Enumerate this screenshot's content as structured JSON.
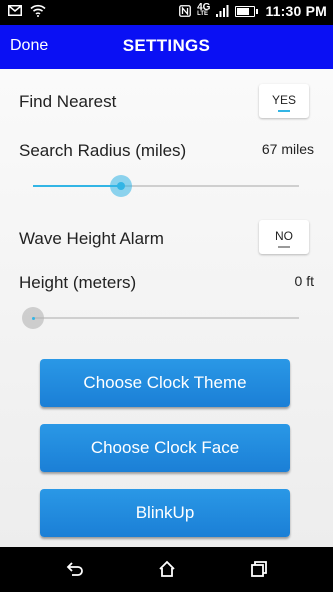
{
  "status_bar": {
    "network_label": "4G",
    "network_sublabel": "LTE",
    "time": "11:30",
    "time_suffix": "PM"
  },
  "header": {
    "done_label": "Done",
    "title": "SETTINGS"
  },
  "settings": {
    "find_nearest": {
      "label": "Find Nearest",
      "toggle": "YES",
      "on": true
    },
    "search_radius": {
      "label": "Search Radius (miles)",
      "value": "67 miles",
      "slider_fraction": 0.33
    },
    "wave_alarm": {
      "label": "Wave Height Alarm",
      "toggle": "NO",
      "on": false
    },
    "height": {
      "label": "Height (meters)",
      "value": "0 ft",
      "slider_fraction": 0.0
    }
  },
  "buttons": {
    "clock_theme": "Choose Clock Theme",
    "clock_face": "Choose Clock Face",
    "blinkup": "BlinkUp"
  },
  "colors": {
    "title_bar": "#0a10f4",
    "accent": "#33b5e5",
    "button": "#1b7fd6"
  }
}
